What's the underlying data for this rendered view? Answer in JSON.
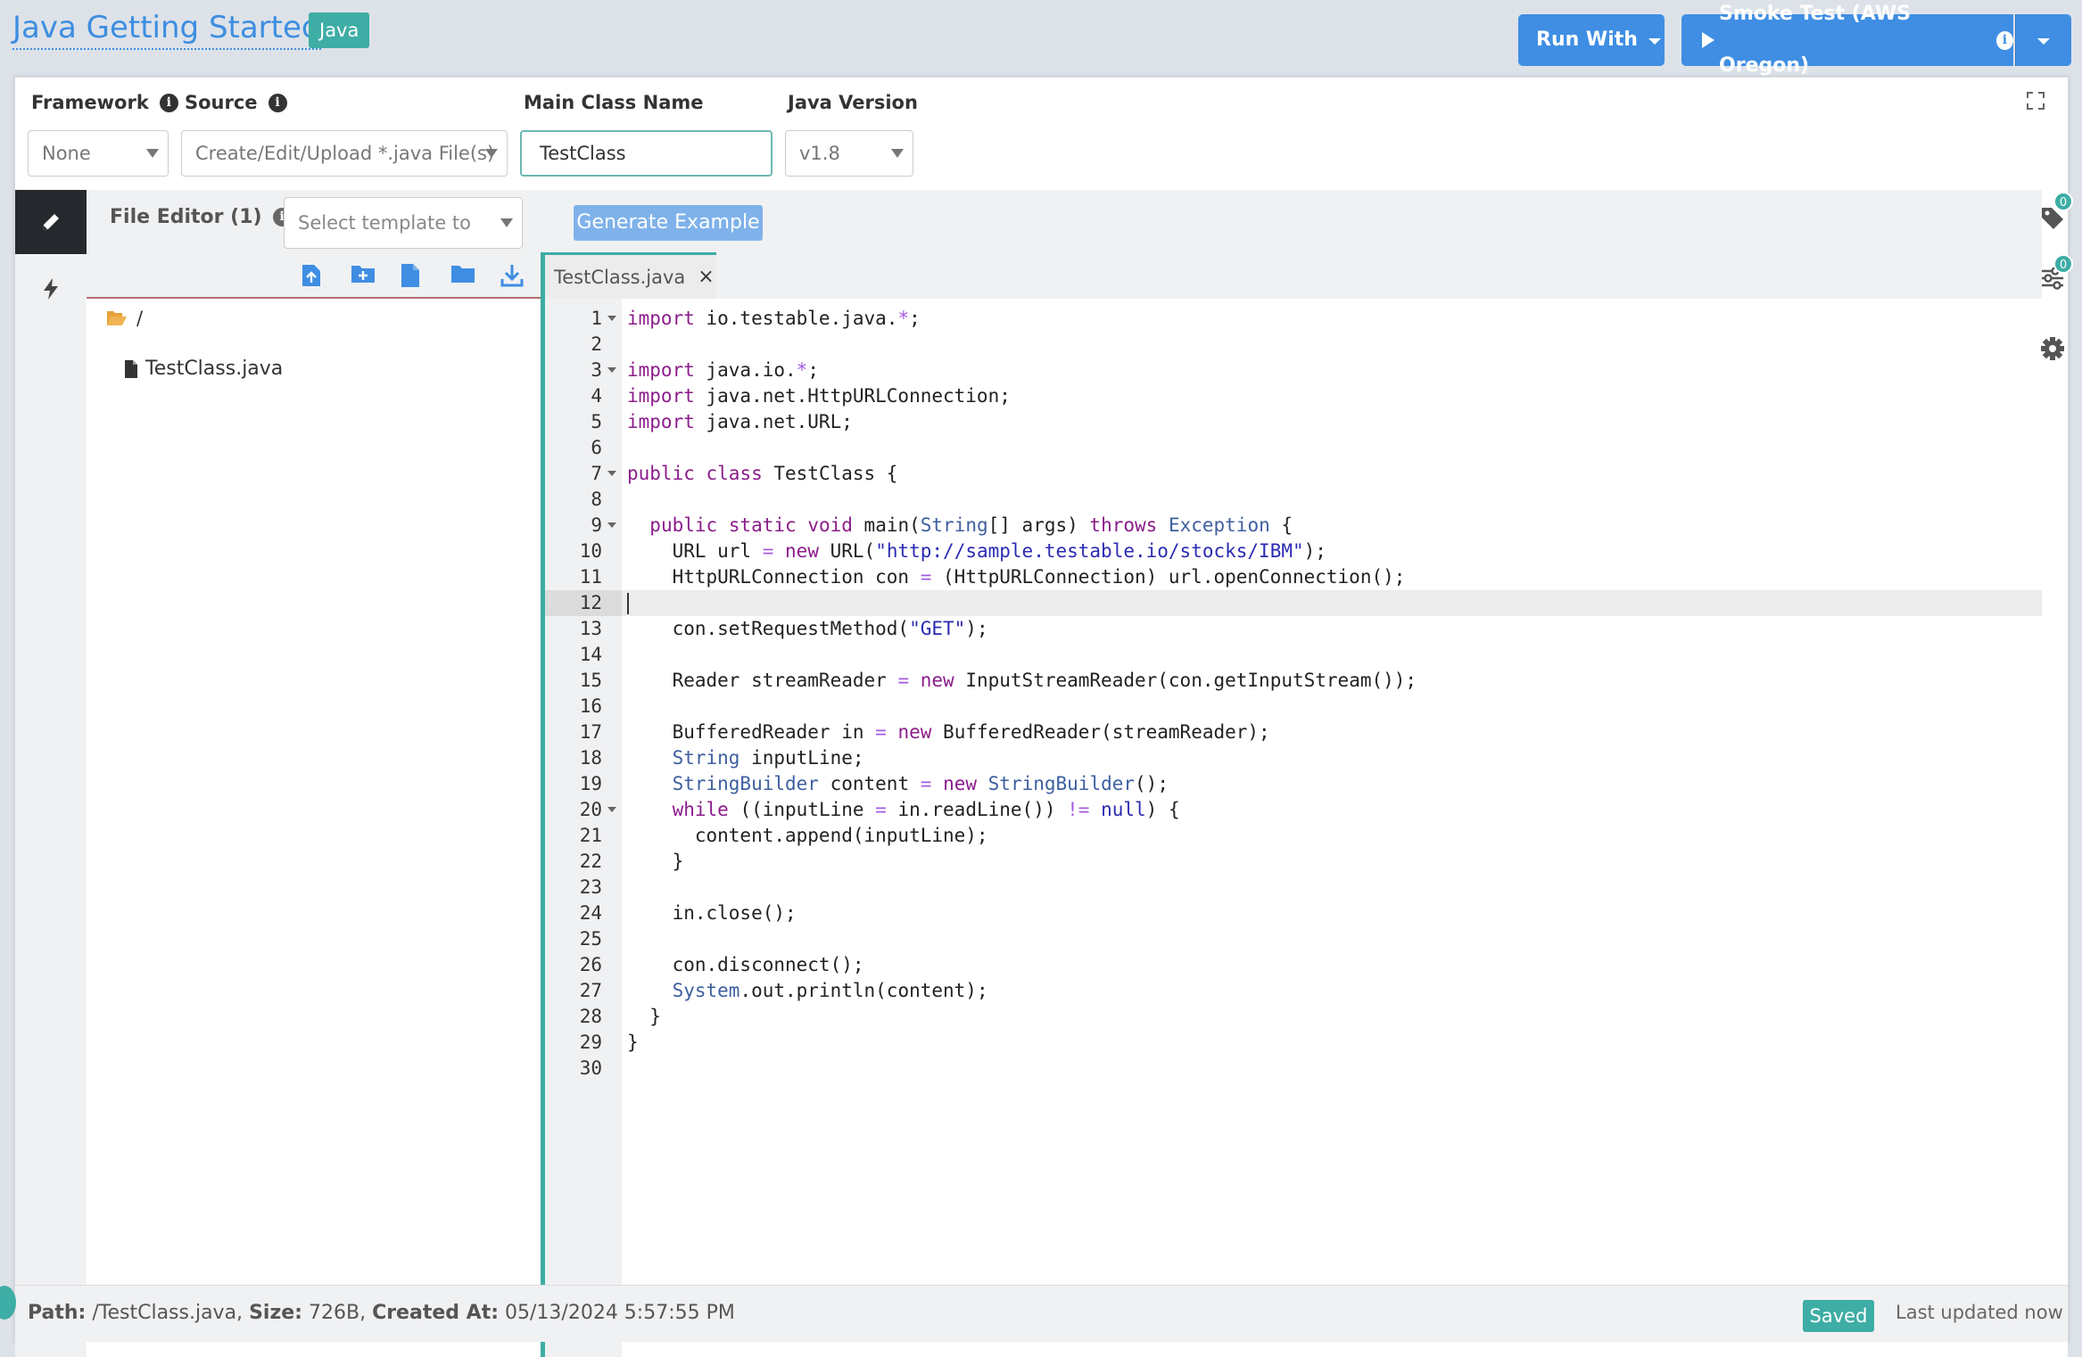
{
  "header": {
    "title": "Java Getting Started",
    "badge": "Java",
    "run_with_label": "Run With",
    "smoke_test_label": "Smoke Test (AWS Oregon)"
  },
  "config": {
    "framework_label": "Framework",
    "framework_value": "None",
    "source_label": "Source",
    "source_value": "Create/Edit/Upload *.java File(s)",
    "main_class_label": "Main Class Name",
    "main_class_value": "TestClass",
    "java_version_label": "Java Version",
    "java_version_value": "v1.8"
  },
  "toolbar": {
    "file_editor_label": "File Editor (1)",
    "template_placeholder": "Select template to insert...",
    "generate_label": "Generate Example"
  },
  "tree": {
    "root": "/",
    "files": [
      "TestClass.java"
    ]
  },
  "tabs": [
    {
      "label": "TestClass.java",
      "close": "×"
    }
  ],
  "editor": {
    "active_line": 12,
    "lines": [
      "import io.testable.java.*;",
      "",
      "import java.io.*;",
      "import java.net.HttpURLConnection;",
      "import java.net.URL;",
      "",
      "public class TestClass {",
      "",
      "  public static void main(String[] args) throws Exception {",
      "    URL url = new URL(\"http://sample.testable.io/stocks/IBM\");",
      "    HttpURLConnection con = (HttpURLConnection) url.openConnection();",
      "",
      "    con.setRequestMethod(\"GET\");",
      "",
      "    Reader streamReader = new InputStreamReader(con.getInputStream());",
      "",
      "    BufferedReader in = new BufferedReader(streamReader);",
      "    String inputLine;",
      "    StringBuilder content = new StringBuilder();",
      "    while ((inputLine = in.readLine()) != null) {",
      "      content.append(inputLine);",
      "    }",
      "",
      "    in.close();",
      "",
      "    con.disconnect();",
      "    System.out.println(content);",
      "  }",
      "}",
      ""
    ],
    "fold_lines": [
      1,
      3,
      7,
      9,
      20
    ]
  },
  "right_rail": {
    "tags_count": "0",
    "params_count": "0"
  },
  "status": {
    "path_label": "Path:",
    "path_value": "/TestClass.java,",
    "size_label": "Size:",
    "size_value": "726B,",
    "created_label": "Created At:",
    "created_value": "05/13/2024 5:57:55 PM",
    "saved_label": "Saved",
    "last_updated": "Last updated now"
  },
  "colors": {
    "accent_blue": "#3f8ee3",
    "teal": "#3eada5",
    "keyword": "#8b1d8b",
    "type": "#3e5fa0",
    "string": "#2b2bb3"
  }
}
